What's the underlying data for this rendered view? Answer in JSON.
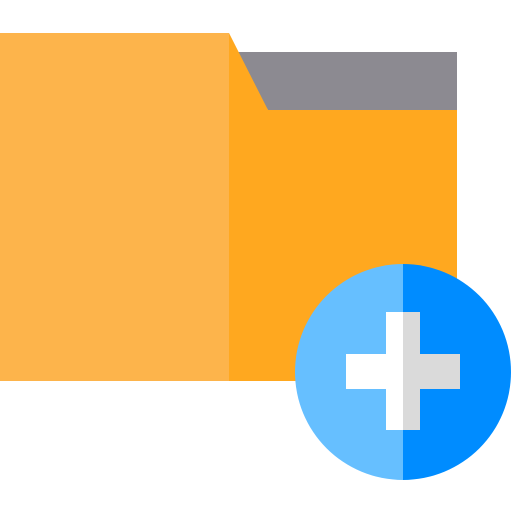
{
  "icon": {
    "name": "add-folder-icon",
    "parts": [
      "folder-icon",
      "plus-circle-icon",
      "plus-icon"
    ]
  },
  "colors": {
    "folder_front_left": "#FDB44B",
    "folder_back_right": "#FFA81F",
    "folder_tab": "#8C8A91",
    "circle_left": "#66BFFF",
    "circle_right": "#008CFF",
    "plus_left": "#FFFFFF",
    "plus_right": "#DADADA"
  }
}
